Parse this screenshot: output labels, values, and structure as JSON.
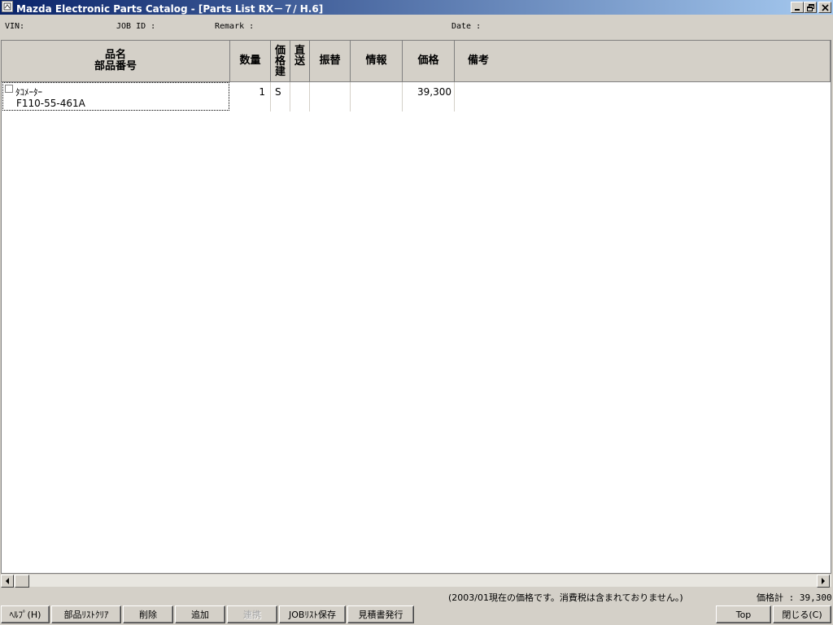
{
  "window": {
    "title": "Mazda Electronic Parts Catalog - [Parts List RX－７/ H.6]"
  },
  "info": {
    "vin_label": "VIN:",
    "job_id_label": "JOB ID :",
    "remark_label": "Remark :",
    "date_label": "Date :"
  },
  "columns": {
    "name_line1": "品名",
    "name_line2": "部品番号",
    "qty": "数量",
    "price_basis": [
      "価",
      "格",
      "建"
    ],
    "direct": [
      "直",
      "送"
    ],
    "transfer": "振替",
    "info": "情報",
    "price": "価格",
    "remarks": "備考"
  },
  "rows": [
    {
      "name": "ﾀｺﾒｰﾀｰ",
      "part_number": "F110-55-461A",
      "qty": "1",
      "price_basis": "S",
      "direct": "",
      "transfer": "",
      "info": "",
      "price": "39,300",
      "remarks": ""
    }
  ],
  "footer": {
    "note": "(2003/01現在の価格です。消費税は含まれておりません。)",
    "total_label": "価格計 : 39,300"
  },
  "buttons": {
    "help": "ﾍﾙﾌﾟ(H)",
    "clear_list": "部品ﾘｽﾄｸﾘｱ",
    "delete": "削除",
    "add": "追加",
    "link": "連携",
    "save_job_list": "JOBﾘｽﾄ保存",
    "issue_quote": "見積書発行",
    "top": "Top",
    "close": "閉じる(C)"
  }
}
